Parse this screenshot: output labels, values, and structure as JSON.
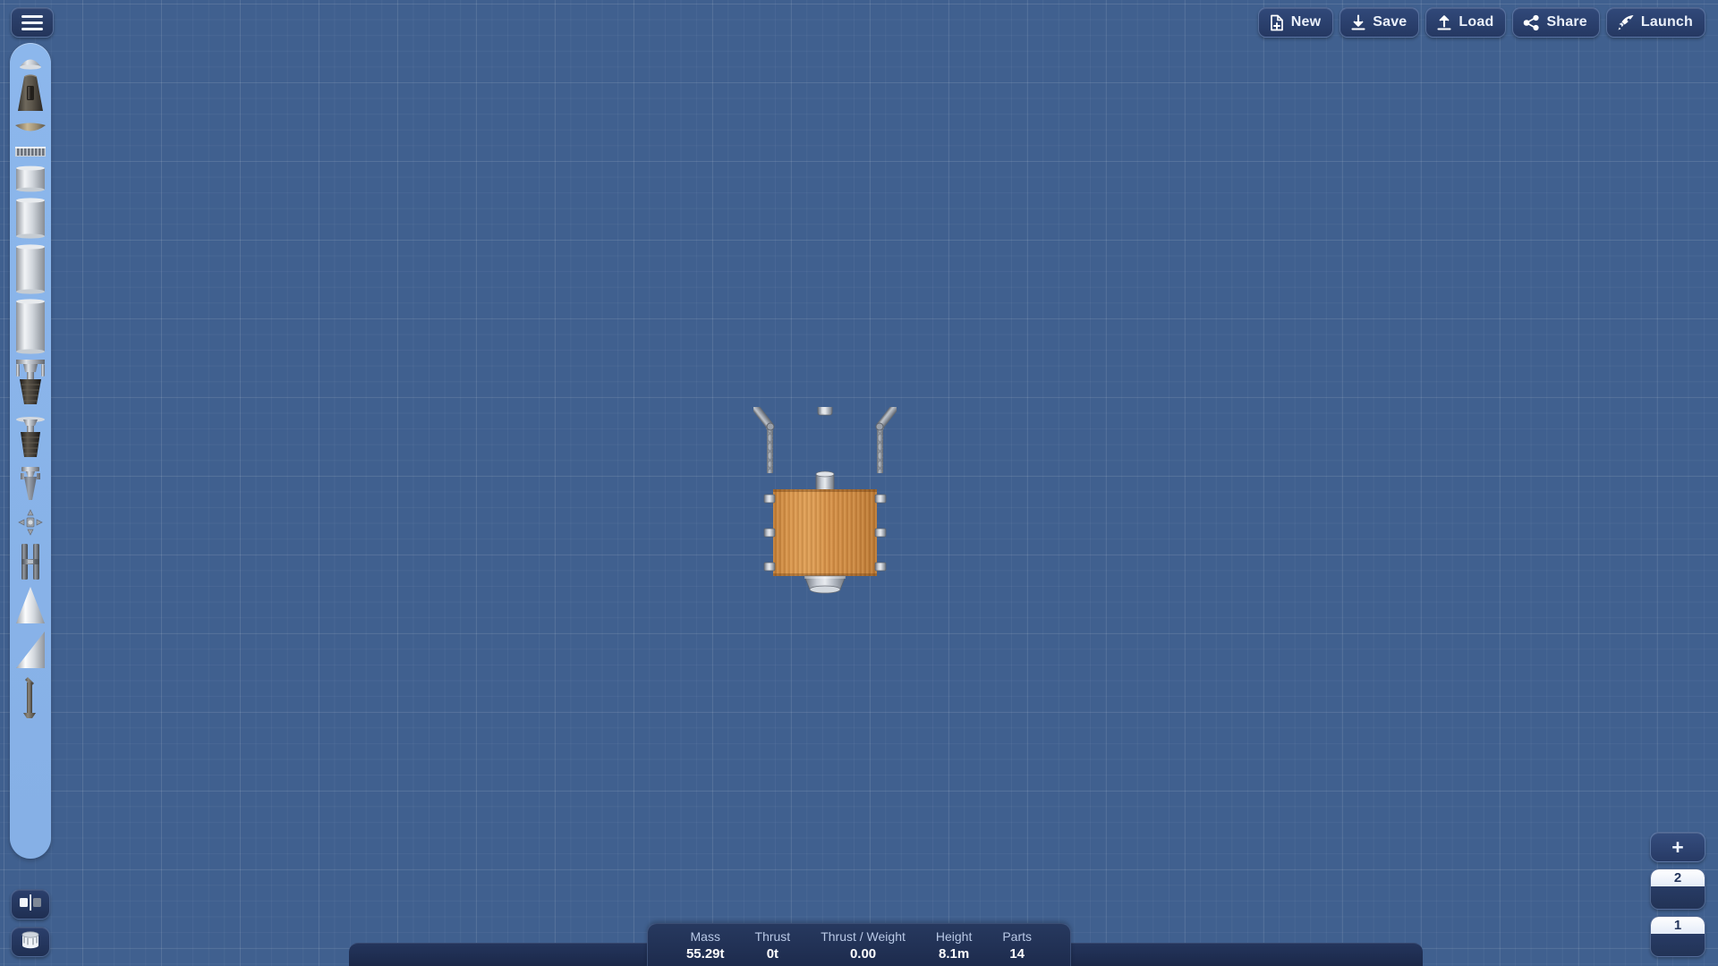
{
  "app": {
    "title": "Spaceflight Simulator - Rocket Builder",
    "background_color": "#40608f",
    "accent_color": "#2e4471"
  },
  "menu": {
    "icon": "hamburger-menu-icon",
    "label": "Menu"
  },
  "toolbar": {
    "buttons": [
      {
        "label": "New",
        "icon": "new-document-icon"
      },
      {
        "label": "Save",
        "icon": "download-save-icon"
      },
      {
        "label": "Load",
        "icon": "upload-load-icon"
      },
      {
        "label": "Share",
        "icon": "share-nodes-icon"
      },
      {
        "label": "Launch",
        "icon": "rocket-launch-icon"
      }
    ]
  },
  "parts_panel": {
    "items": [
      {
        "name": "nose-cone-small",
        "label": "Nose Cone"
      },
      {
        "name": "command-capsule",
        "label": "Command Pod"
      },
      {
        "name": "heat-shield",
        "label": "Heat Shield"
      },
      {
        "name": "solar-panel-band",
        "label": "Solar Panel Band"
      },
      {
        "name": "fuel-tank-short",
        "label": "Fuel Tank (Short)"
      },
      {
        "name": "fuel-tank-medium",
        "label": "Fuel Tank (Medium)"
      },
      {
        "name": "fuel-tank-long",
        "label": "Fuel Tank (Long)"
      },
      {
        "name": "fuel-tank-extra-long",
        "label": "Fuel Tank (Extra Long)"
      },
      {
        "name": "engine-hawk",
        "label": "Hawk Engine"
      },
      {
        "name": "engine-titan",
        "label": "Titan Engine"
      },
      {
        "name": "engine-frontier",
        "label": "Frontier Engine"
      },
      {
        "name": "rcs-thruster",
        "label": "RCS Thruster"
      },
      {
        "name": "separator",
        "label": "Separator"
      },
      {
        "name": "fairing-cone",
        "label": "Fairing Cone"
      },
      {
        "name": "fairing-angled",
        "label": "Angled Fairing"
      },
      {
        "name": "landing-leg",
        "label": "Landing Leg"
      }
    ]
  },
  "tools": {
    "symmetry": {
      "label": "Symmetry",
      "icon": "mirror-symmetry-icon"
    },
    "fuel": {
      "label": "Fuel",
      "icon": "fuel-tank-icon"
    }
  },
  "rocket": {
    "name": "rocket-assembly",
    "parts_description": "Orange fuel tank with A-frame lattice gantry, top docking port, bottom decoupler and six side mounts",
    "tank_color": "#cf8e47",
    "metal_color": "#b9bec6"
  },
  "stats": {
    "items": [
      {
        "label": "Mass",
        "value": "55.29t"
      },
      {
        "label": "Thrust",
        "value": "0t"
      },
      {
        "label": "Thrust / Weight",
        "value": "0.00"
      },
      {
        "label": "Height",
        "value": "8.1m"
      },
      {
        "label": "Parts",
        "value": "14"
      }
    ]
  },
  "staging": {
    "add_label": "+",
    "stages": [
      {
        "number": "2"
      },
      {
        "number": "1"
      }
    ]
  }
}
